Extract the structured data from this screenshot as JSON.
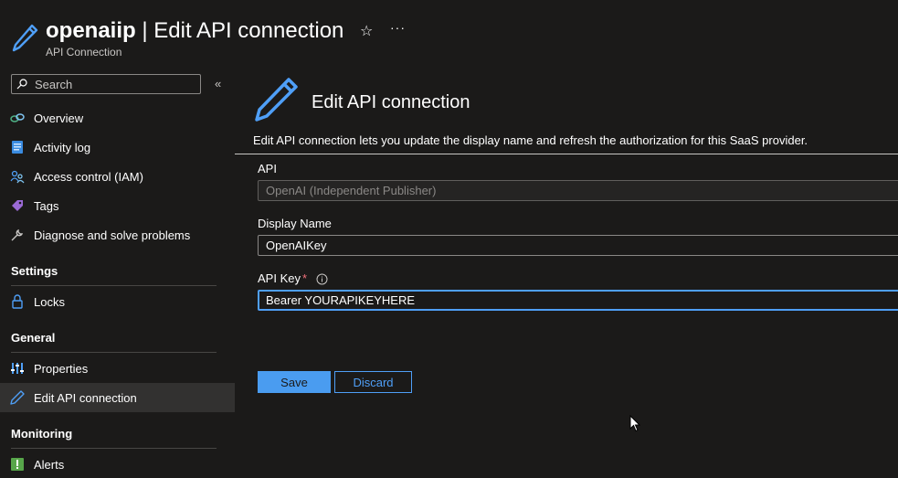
{
  "header": {
    "resource_name": "openaiip",
    "separator": " | ",
    "page_name": "Edit API connection",
    "subtitle": "API Connection",
    "favorite_icon": "star-icon",
    "more_label": "···"
  },
  "sidebar": {
    "search_placeholder": "Search",
    "collapse_label": "«",
    "items": [
      {
        "label": "Overview",
        "icon": "link-icon"
      },
      {
        "label": "Activity log",
        "icon": "activity-log-icon"
      },
      {
        "label": "Access control (IAM)",
        "icon": "people-icon"
      },
      {
        "label": "Tags",
        "icon": "tag-icon"
      },
      {
        "label": "Diagnose and solve problems",
        "icon": "wrench-icon"
      }
    ],
    "sections": [
      {
        "title": "Settings",
        "items": [
          {
            "label": "Locks",
            "icon": "lock-icon"
          }
        ]
      },
      {
        "title": "General",
        "items": [
          {
            "label": "Properties",
            "icon": "properties-icon"
          },
          {
            "label": "Edit API connection",
            "icon": "pencil-icon",
            "active": true
          }
        ]
      },
      {
        "title": "Monitoring",
        "items": [
          {
            "label": "Alerts",
            "icon": "alert-icon"
          }
        ]
      }
    ]
  },
  "main": {
    "title": "Edit API connection",
    "description": "Edit API connection lets you update the display name and refresh the authorization for this SaaS provider.",
    "fields": {
      "api": {
        "label": "API",
        "value": "OpenAI (Independent Publisher)"
      },
      "display_name": {
        "label": "Display Name",
        "value": "OpenAIKey"
      },
      "api_key": {
        "label": "API Key",
        "required_marker": "*",
        "value": "Bearer YOURAPIKEYHERE"
      }
    },
    "buttons": {
      "save": "Save",
      "discard": "Discard"
    }
  },
  "colors": {
    "background": "#1b1a19",
    "accent": "#4a9cf0",
    "active_nav": "#323130",
    "required": "#f1707b"
  }
}
